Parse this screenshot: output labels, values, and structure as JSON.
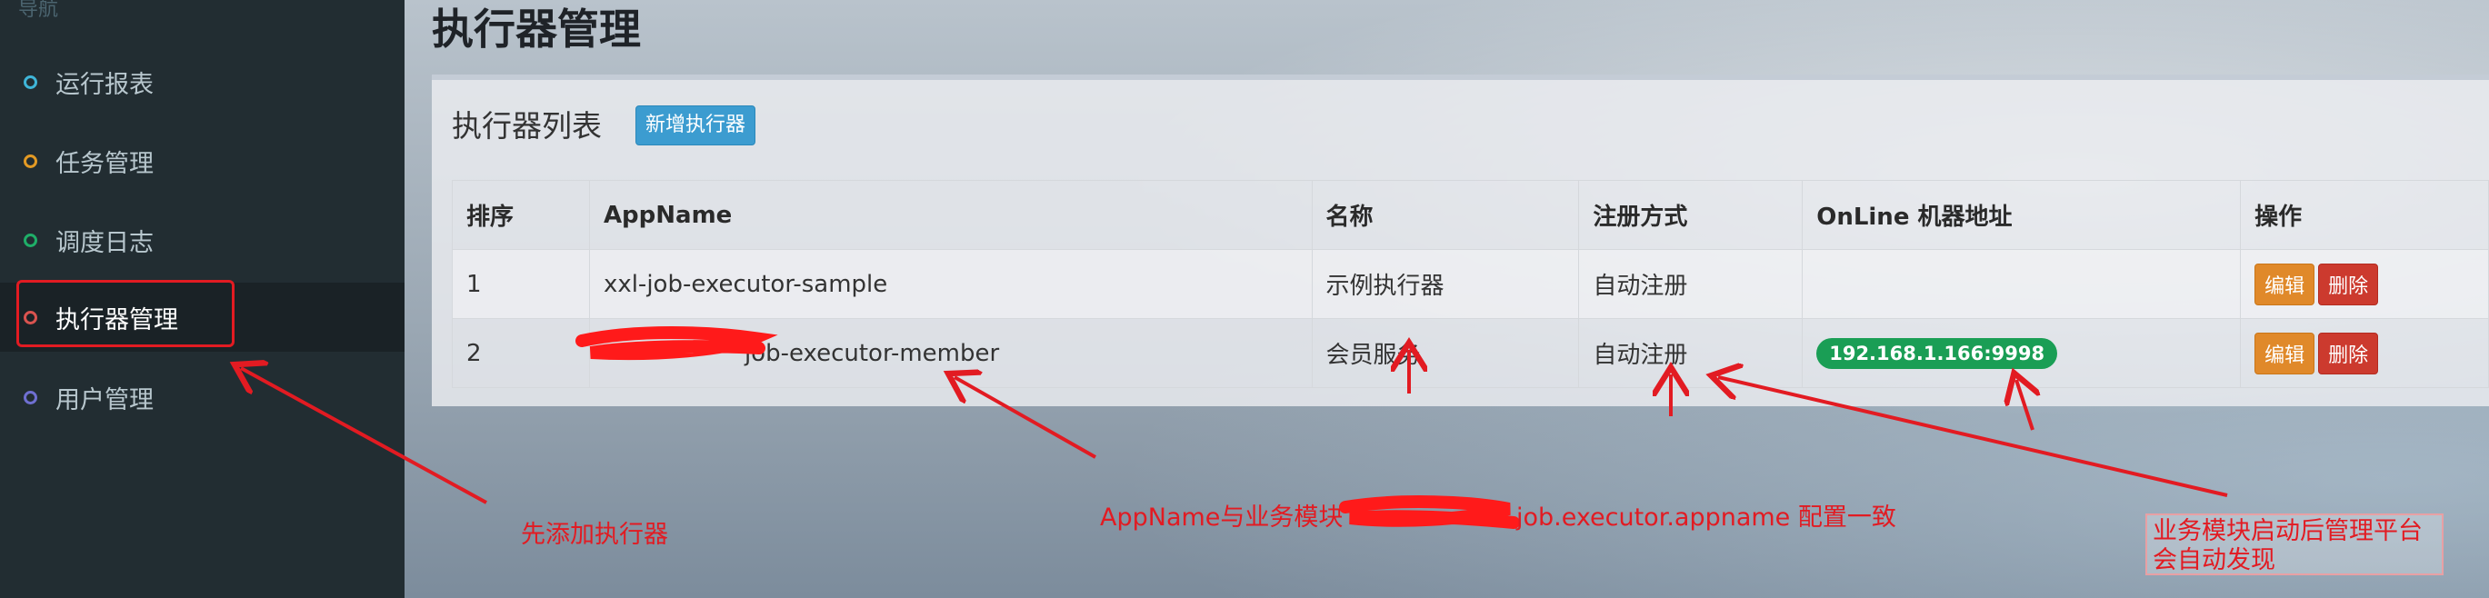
{
  "sidebar": {
    "header": "导航",
    "items": [
      {
        "label": "运行报表",
        "color": "#3fb5d8"
      },
      {
        "label": "任务管理",
        "color": "#e39a24"
      },
      {
        "label": "调度日志",
        "color": "#1fae68"
      },
      {
        "label": "执行器管理",
        "color": "#d9534f"
      },
      {
        "label": "用户管理",
        "color": "#6f6fd1"
      }
    ]
  },
  "main": {
    "title": "执行器管理",
    "box_title": "执行器列表",
    "add_button": "新增执行器",
    "table": {
      "headers": [
        "排序",
        "AppName",
        "名称",
        "注册方式",
        "OnLine 机器地址",
        "操作"
      ],
      "rows": [
        {
          "order": "1",
          "appname": "xxl-job-executor-sample",
          "name": "示例执行器",
          "reg": "自动注册",
          "address": "",
          "edit": "编辑",
          "del": "删除"
        },
        {
          "order": "2",
          "appname": "job-executor-member",
          "name": "会员服务",
          "reg": "自动注册",
          "address": "192.168.1.166:9998",
          "edit": "编辑",
          "del": "删除"
        }
      ]
    }
  },
  "annotations": {
    "add_first": "先添加执行器",
    "appname_prefix": "AppName与业务模块",
    "appname_suffix": "job.executor.appname 配置一致",
    "auto_discover": "业务模块启动后管理平台会自动发现"
  },
  "colors": {
    "annotation": "#e21b22",
    "online_badge": "#1a9e55"
  }
}
